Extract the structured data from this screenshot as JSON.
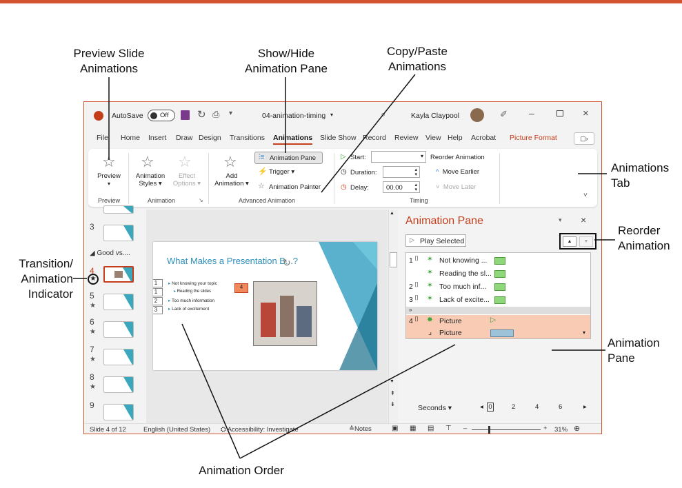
{
  "callouts": {
    "preview": "Preview Slide\nAnimations",
    "preview_l1": "Preview Slide",
    "preview_l2": "Animations",
    "showhide_l1": "Show/Hide",
    "showhide_l2": "Animation Pane",
    "copypaste_l1": "Copy/Paste",
    "copypaste_l2": "Animations",
    "animtab_l1": "Animations",
    "animtab_l2": "Tab",
    "reorder_l1": "Reorder",
    "reorder_l2": "Animation",
    "transition_l1": "Transition/",
    "transition_l2": "Animation",
    "transition_l3": "Indicator",
    "pane_l1": "Animation",
    "pane_l2": "Pane",
    "order": "Animation Order"
  },
  "titlebar": {
    "app_icon": "powerpoint-icon",
    "autosave": "AutoSave",
    "toggle": "Off",
    "filename": "04-animation-timing",
    "user": "Kayla Claypool"
  },
  "tabs": [
    "File",
    "Home",
    "Insert",
    "Draw",
    "Design",
    "Transitions",
    "Animations",
    "Slide Show",
    "Record",
    "Review",
    "View",
    "Help",
    "Acrobat",
    "Picture Format"
  ],
  "ribbon": {
    "preview": "Preview",
    "preview_group": "Preview",
    "anim_styles": "Animation",
    "anim_styles2": "Styles",
    "effect": "Effect",
    "effect2": "Options",
    "animation_group": "Animation",
    "add": "Add",
    "add2": "Animation",
    "animation_pane": "Animation Pane",
    "trigger": "Trigger",
    "painter": "Animation Painter",
    "advanced_group": "Advanced Animation",
    "start": "Start:",
    "duration": "Duration:",
    "delay": "Delay:",
    "delay_value": "00.00",
    "timing_group": "Timing",
    "reorder": "Reorder Animation",
    "move_earlier": "Move Earlier",
    "move_later": "Move Later"
  },
  "thumbs": {
    "section": "Good vs....",
    "numbers": [
      "3",
      "4",
      "5",
      "6",
      "7",
      "8",
      "9"
    ]
  },
  "slide": {
    "title": "What Makes a Presentation B...?",
    "bullets": [
      "Not knowing your topic",
      "Reading the slides",
      "Too much information",
      "Lack of excitement"
    ],
    "tags": [
      "1",
      "1",
      "2",
      "3"
    ],
    "pic_tag": "4"
  },
  "pane": {
    "title": "Animation Pane",
    "play": "Play Selected",
    "items": [
      {
        "num": "1",
        "label": "Not knowing ..."
      },
      {
        "num": "",
        "label": "Reading the sl..."
      },
      {
        "num": "2",
        "label": "Too much inf..."
      },
      {
        "num": "3",
        "label": "Lack of excite..."
      }
    ],
    "sel1_num": "4",
    "sel1_label": "Picture",
    "sel2_label": "Picture",
    "seconds": "Seconds",
    "ticks": [
      "0",
      "2",
      "4",
      "6"
    ]
  },
  "status": {
    "slide": "Slide 4 of 12",
    "lang": "English (United States)",
    "access": "Accessibility: Investigate",
    "notes": "Notes",
    "zoom": "31%"
  },
  "colors": {
    "accent": "#d35230",
    "pane_title": "#c43e1c",
    "selected": "#f9cbb5",
    "teal": "#3aa7bd"
  }
}
